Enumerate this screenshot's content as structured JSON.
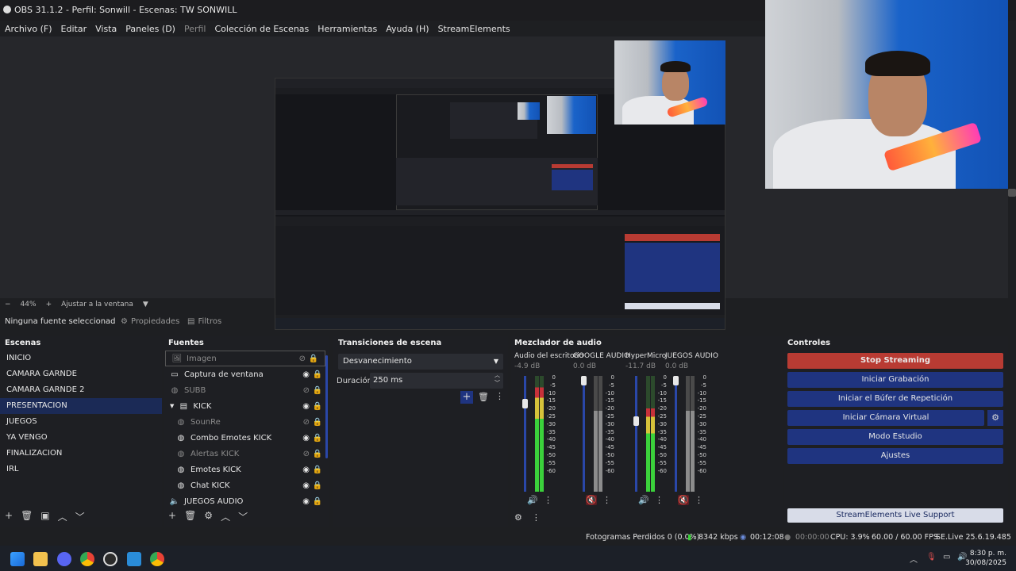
{
  "window": {
    "title": "OBS 31.1.2 - Perfil: Sonwill - Escenas: TW SONWILL"
  },
  "menu": [
    "Archivo (F)",
    "Editar",
    "Vista",
    "Paneles (D)",
    "Perfil",
    "Colección de Escenas",
    "Herramientas",
    "Ayuda (H)",
    "StreamElements"
  ],
  "zoom": {
    "value": "44%",
    "fit_label": "Ajustar a la ventana"
  },
  "source_toolbar": {
    "no_selection": "Ninguna fuente seleccionad",
    "properties": "Propiedades",
    "filters": "Filtros"
  },
  "scenes": {
    "title": "Escenas",
    "items": [
      "INICIO",
      "CAMARA GARNDE",
      "CAMARA GARNDE 2",
      "PRESENTACION",
      "JUEGOS",
      "YA VENGO",
      "FINALIZACION",
      "IRL"
    ],
    "selected_index": 3
  },
  "sources": {
    "title": "Fuentes",
    "items": [
      {
        "name": "Imagen",
        "icon": "image-icon",
        "visible": false,
        "locked": true,
        "indent": 0
      },
      {
        "name": "Captura de ventana",
        "icon": "window-capture-icon",
        "visible": true,
        "locked": true,
        "indent": 0
      },
      {
        "name": "SUBB",
        "icon": "browser-icon",
        "visible": false,
        "locked": true,
        "indent": 0
      },
      {
        "name": "KICK",
        "icon": "folder-icon",
        "visible": true,
        "locked": true,
        "indent": 0
      },
      {
        "name": "SounRe",
        "icon": "browser-icon",
        "visible": false,
        "locked": true,
        "indent": 1
      },
      {
        "name": "Combo Emotes KICK",
        "icon": "browser-icon",
        "visible": true,
        "locked": true,
        "indent": 1
      },
      {
        "name": "Alertas KICK",
        "icon": "browser-icon",
        "visible": false,
        "locked": true,
        "indent": 1
      },
      {
        "name": "Emotes KICK",
        "icon": "browser-icon",
        "visible": true,
        "locked": true,
        "indent": 1
      },
      {
        "name": "Chat KICK",
        "icon": "browser-icon",
        "visible": true,
        "locked": true,
        "indent": 1
      },
      {
        "name": "JUEGOS AUDIO",
        "icon": "audio-icon",
        "visible": true,
        "locked": true,
        "indent": 0
      }
    ]
  },
  "transitions": {
    "title": "Transiciones de escena",
    "selected": "Desvanecimiento",
    "duration_label": "Duración",
    "duration_value": "250 ms"
  },
  "mixer": {
    "title": "Mezclador de audio",
    "scale": [
      "0",
      "-5",
      "-10",
      "-15",
      "-20",
      "-25",
      "-30",
      "-35",
      "-40",
      "-45",
      "-50",
      "-55",
      "-60"
    ],
    "channels": [
      {
        "name": "Audio del escritorio",
        "db": "-4.9 dB",
        "level": 0.9,
        "fader": 0.78,
        "muted": false
      },
      {
        "name": "GOOGLE AUDIO",
        "db": "0.0 dB",
        "level": 0.0,
        "fader": 1.0,
        "muted": true
      },
      {
        "name": "HyperMicro",
        "db": "-11.7 dB",
        "level": 0.72,
        "fader": 0.62,
        "muted": false
      },
      {
        "name": "JUEGOS AUDIO",
        "db": "0.0 dB",
        "level": 0.0,
        "fader": 1.0,
        "muted": true
      }
    ]
  },
  "controls": {
    "title": "Controles",
    "buttons": [
      "Stop Streaming",
      "Iniciar Grabación",
      "Iniciar el Búfer de Repetición",
      "Iniciar Cámara Virtual",
      "Modo Estudio",
      "Ajustes"
    ],
    "support": "StreamElements Live Support"
  },
  "status": {
    "dropped": "Fotogramas Perdidos 0 (0.0%)",
    "bitrate": "8342 kbps",
    "stream_time": "00:12:08",
    "rec_time": "00:00:00",
    "cpu": "CPU: 3.9%",
    "fps": "60.00 / 60.00 FPS",
    "version": "SE.Live 25.6.19.485"
  },
  "taskbar": {
    "time": "8:30 p. m.",
    "date": "30/08/2025"
  },
  "colors": {
    "accent_blue": "#1f3480",
    "stop_red": "#b83b33",
    "selected_scene": "#1b2a56",
    "meter_green": "#3bd13b",
    "meter_yellow": "#d6c23a",
    "meter_red": "#c8313a"
  }
}
